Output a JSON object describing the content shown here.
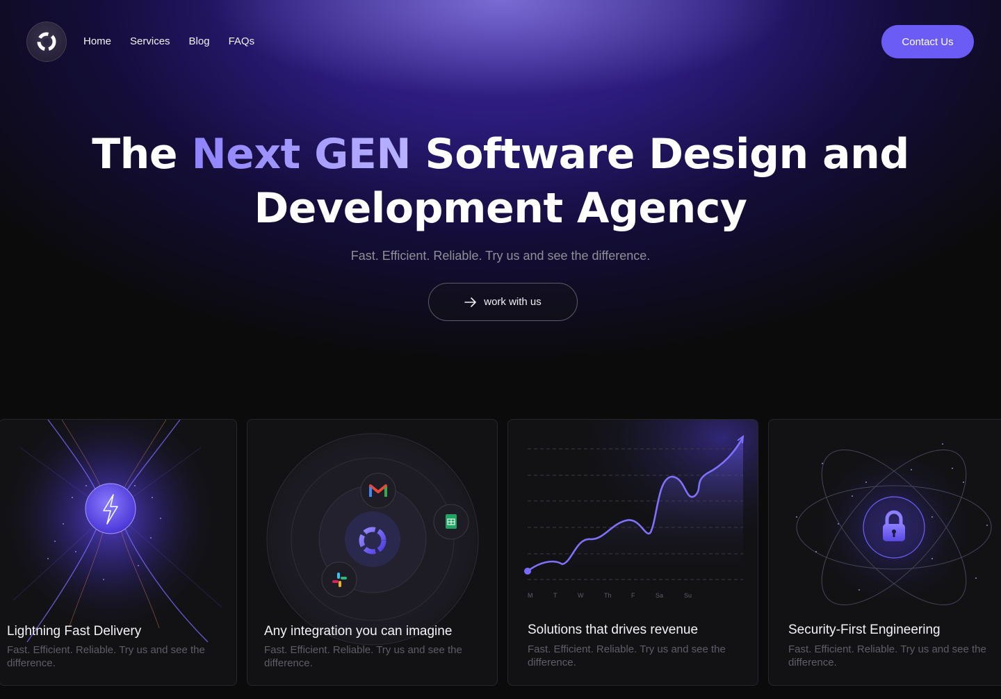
{
  "nav": {
    "items": [
      "Home",
      "Services",
      "Blog",
      "FAQs"
    ],
    "contact_label": "Contact Us"
  },
  "hero": {
    "title_pre": "The ",
    "title_accent": "Next GEN",
    "title_post": " Software Design and Development Agency",
    "subtitle": "Fast. Efficient. Reliable. Try us and see the difference.",
    "cta_label": "work with us"
  },
  "cards": [
    {
      "title": "Lightning Fast Delivery",
      "desc": "Fast. Efficient. Reliable. Try us and see the difference."
    },
    {
      "title": "Any integration you can imagine",
      "desc": "Fast. Efficient. Reliable. Try us and see the difference."
    },
    {
      "title": "Solutions that drives revenue",
      "desc": "Fast. Efficient. Reliable. Try us and see the difference."
    },
    {
      "title": "Security-First Engineering",
      "desc": "Fast. Efficient. Reliable. Try us and see the difference."
    }
  ],
  "revenue_chart": {
    "days": [
      "M",
      "T",
      "W",
      "Th",
      "F",
      "Sa",
      "Su"
    ]
  },
  "colors": {
    "accent": "#6b5cf6",
    "background": "#0b0b0c",
    "card": "#121214"
  },
  "icons": [
    "logo-icon",
    "arrow-right-icon",
    "lightning-icon",
    "gmail-icon",
    "sheets-icon",
    "slack-icon",
    "lock-icon"
  ]
}
